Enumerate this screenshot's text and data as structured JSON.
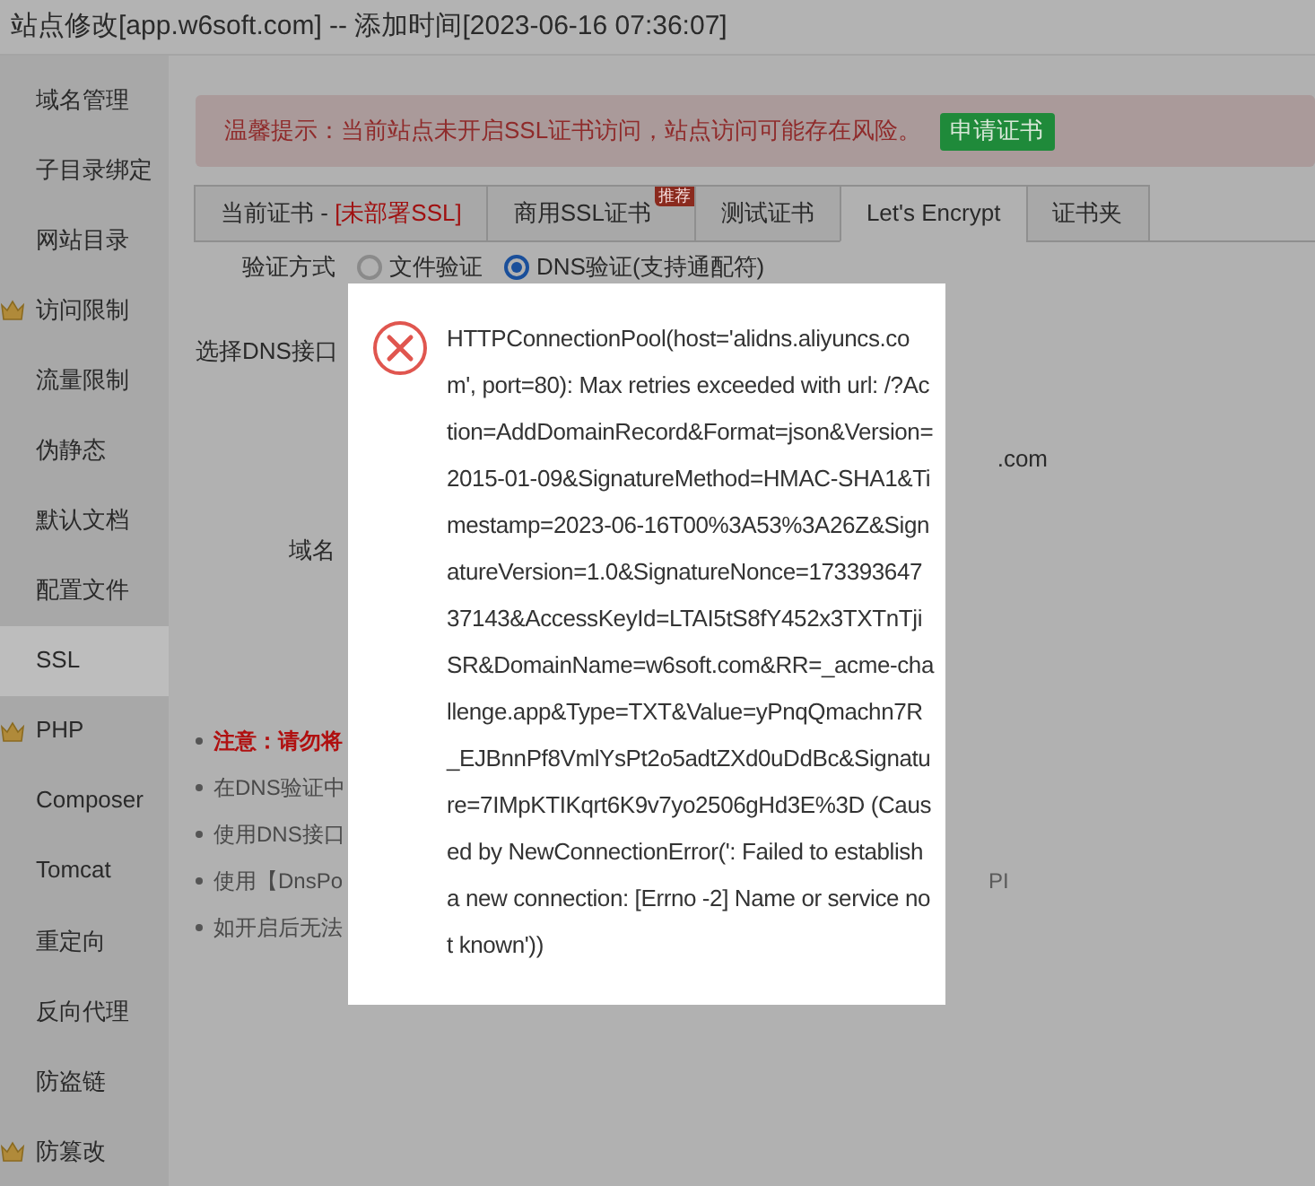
{
  "window": {
    "title": "站点修改[app.w6soft.com] -- 添加时间[2023-06-16 07:36:07]"
  },
  "sidebar": {
    "items": [
      {
        "label": "域名管理",
        "selected": false,
        "premium": false
      },
      {
        "label": "子目录绑定",
        "selected": false,
        "premium": false
      },
      {
        "label": "网站目录",
        "selected": false,
        "premium": false
      },
      {
        "label": "访问限制",
        "selected": false,
        "premium": true
      },
      {
        "label": "流量限制",
        "selected": false,
        "premium": false
      },
      {
        "label": "伪静态",
        "selected": false,
        "premium": false
      },
      {
        "label": "默认文档",
        "selected": false,
        "premium": false
      },
      {
        "label": "配置文件",
        "selected": false,
        "premium": false
      },
      {
        "label": "SSL",
        "selected": true,
        "premium": false
      },
      {
        "label": "PHP",
        "selected": false,
        "premium": true
      },
      {
        "label": "Composer",
        "selected": false,
        "premium": false
      },
      {
        "label": "Tomcat",
        "selected": false,
        "premium": false
      },
      {
        "label": "重定向",
        "selected": false,
        "premium": false
      },
      {
        "label": "反向代理",
        "selected": false,
        "premium": false
      },
      {
        "label": "防盗链",
        "selected": false,
        "premium": false
      },
      {
        "label": "防篡改",
        "selected": false,
        "premium": true
      }
    ]
  },
  "alert": {
    "text": "温馨提示：当前站点未开启SSL证书访问，站点访问可能存在风险。",
    "button": "申请证书"
  },
  "tabs": [
    {
      "label": "当前证书 - ",
      "status": "[未部署SSL]",
      "selected": false
    },
    {
      "label": "商用SSL证书",
      "ribbon": "推荐",
      "selected": false
    },
    {
      "label": "测试证书",
      "selected": false
    },
    {
      "label": "Let's Encrypt",
      "selected": true
    },
    {
      "label": "证书夹",
      "selected": false
    }
  ],
  "form": {
    "verify_label": "验证方式",
    "options": [
      {
        "label": "文件验证",
        "selected": false
      },
      {
        "label": "DNS验证(支持通配符)",
        "selected": true
      }
    ],
    "dns_label": "选择DNS接口",
    "domain_fragment": ".com",
    "domain_label": "域名"
  },
  "notes": [
    {
      "text": "注意：请勿将",
      "kind": "warning"
    },
    {
      "text": "在DNS验证中",
      "kind": "plain"
    },
    {
      "text": "使用DNS接口",
      "kind": "plain"
    },
    {
      "text": "使用【DnsPo",
      "kind": "plain",
      "tail": "PI"
    },
    {
      "text": "如开启后无法",
      "kind": "plain"
    }
  ],
  "dialog": {
    "message": "HTTPConnectionPool(host='alidns.aliyuncs.com', port=80): Max retries exceeded with url: /?Action=AddDomainRecord&Format=json&Version=2015-01-09&SignatureMethod=HMAC-SHA1&Timestamp=2023-06-16T00%3A53%3A26Z&SignatureVersion=1.0&SignatureNonce=17339364737143&AccessKeyId=LTAI5tS8fY452x3TXTnTjiSR&DomainName=w6soft.com&RR=_acme-challenge.app&Type=TXT&Value=yPnqQmachn7R_EJBnnPf8VmlYsPt2o5adtZXd0uDdBc&Signature=7IMpKTIKqrt6K9v7yo2506gHd3E%3D (Caused by NewConnectionError(': Failed to establish a new connection: [Errno -2] Name or service not known'))"
  }
}
